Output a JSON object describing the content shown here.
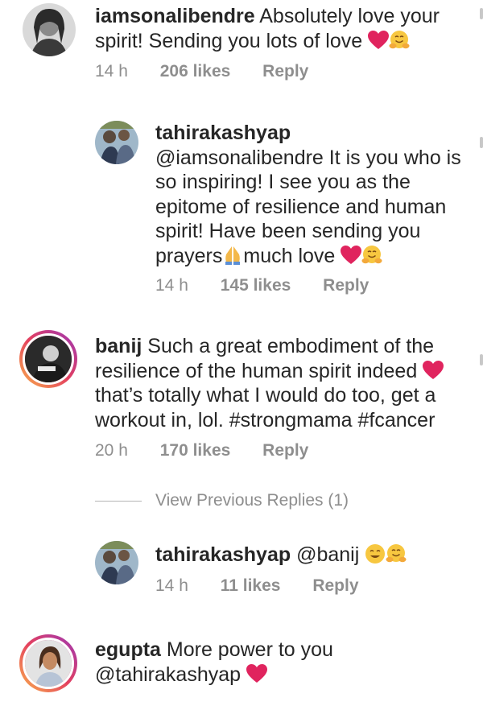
{
  "comments": [
    {
      "username": "iamsonalibendre",
      "text": "Absolutely love your spirit! Sending you lots of love",
      "time": "14 h",
      "likes": "206 likes",
      "reply": "Reply",
      "emojis": [
        "heart",
        "hugging-face"
      ]
    },
    {
      "username": "tahirakashyap",
      "text_a": "@iamsonalibendre It is you who is so inspiring! I see you as the epitome of resilience and human spirit! Have been sending you prayers",
      "text_b": "much love",
      "time": "14 h",
      "likes": "145 likes",
      "reply": "Reply",
      "emojis": [
        "folded-hands",
        "heart",
        "hugging-face"
      ]
    },
    {
      "username": "banij",
      "text_a": "Such a great embodiment of the resilience of the human spirit indeed",
      "text_b": "that’s totally what I would do too, get a workout in, lol. #strongmama #fcancer",
      "time": "20 h",
      "likes": "170 likes",
      "reply": "Reply",
      "emojis": [
        "heart"
      ]
    },
    {
      "username": "tahirakashyap",
      "text": "@banij",
      "time": "14 h",
      "likes": "11 likes",
      "reply": "Reply",
      "emojis": [
        "smiling-face",
        "hugging-face"
      ]
    },
    {
      "username": "egupta",
      "text": "More power to you @tahirakashyap",
      "emojis": [
        "heart"
      ]
    }
  ],
  "view_previous": "View Previous Replies (1)",
  "colors": {
    "text": "#262626",
    "meta": "#8e8e8e",
    "heart": "#e0245e",
    "emoji_yellow": "#f7c740"
  }
}
